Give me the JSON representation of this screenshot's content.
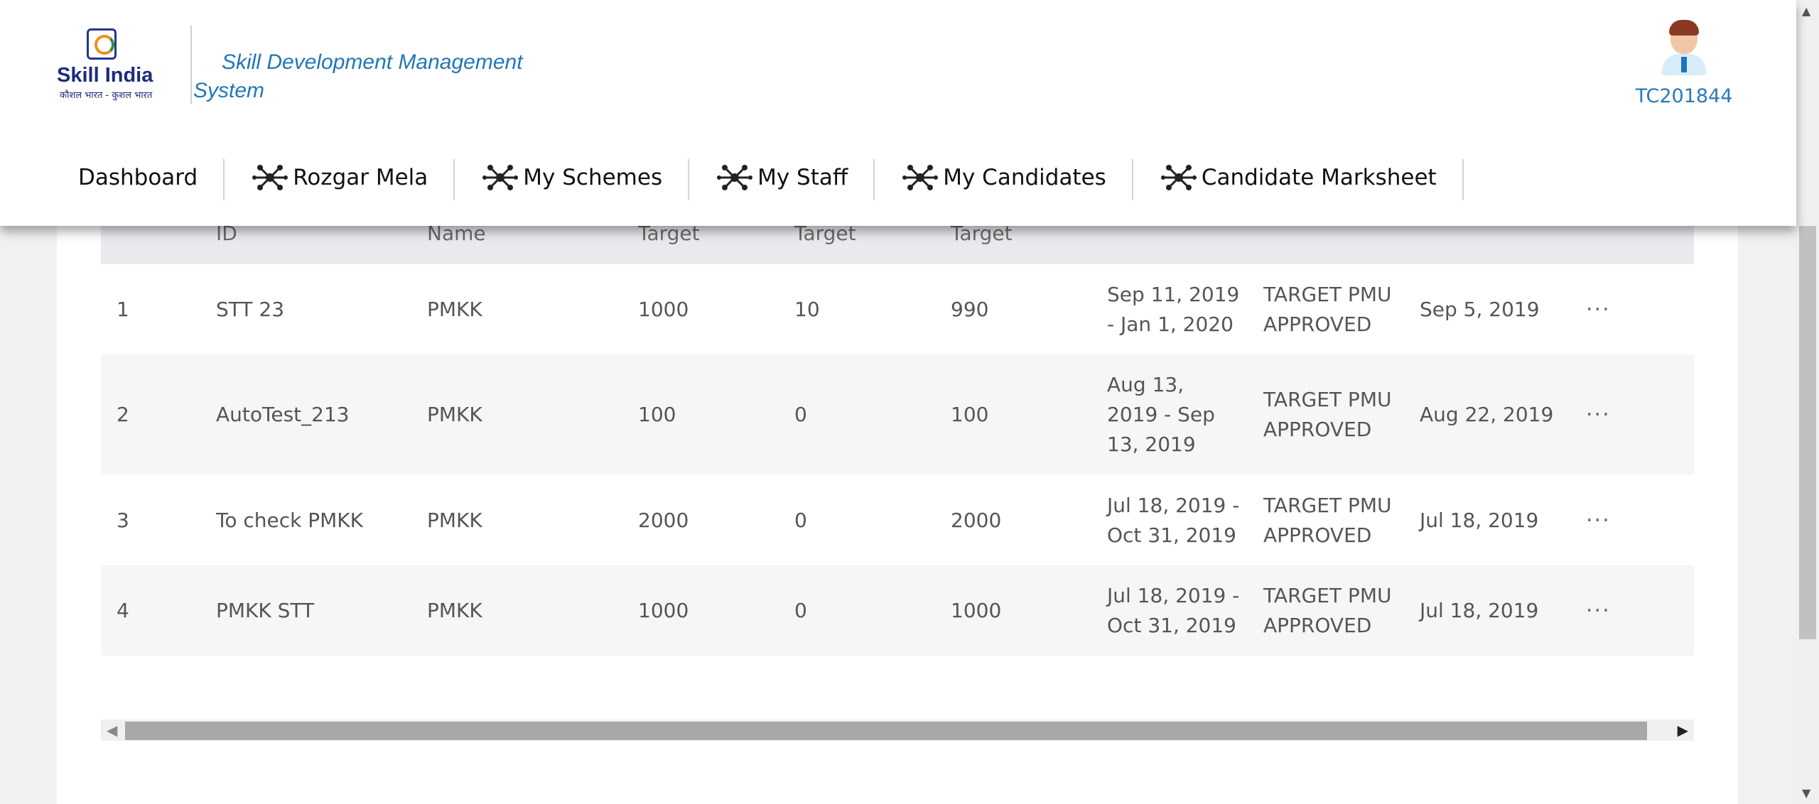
{
  "header": {
    "logo": {
      "brand": "Skill India",
      "tagline": "कौशल भारत - कुशल भारत"
    },
    "app_title": "Skill Development Management System",
    "user_id": "TC201844"
  },
  "nav": {
    "items": [
      {
        "label": "Dashboard",
        "icon": "none"
      },
      {
        "label": "Rozgar Mela",
        "icon": "network-icon"
      },
      {
        "label": "My Schemes",
        "icon": "network-icon"
      },
      {
        "label": "My Staff",
        "icon": "network-icon"
      },
      {
        "label": "My Candidates",
        "icon": "network-icon"
      },
      {
        "label": "Candidate Marksheet",
        "icon": "network-icon"
      }
    ]
  },
  "table": {
    "headers": [
      "",
      "ID",
      "Name",
      "Target",
      "Target",
      "Target",
      "",
      "",
      "",
      ""
    ],
    "rows": [
      {
        "sno": "1",
        "id": "STT 23",
        "name": "PMKK",
        "t1": "1000",
        "t2": "10",
        "t3": "990",
        "duration": "Sep 11, 2019 - Jan 1, 2020",
        "status": "TARGET PMU APPROVED",
        "date": "Sep 5, 2019",
        "more": "···"
      },
      {
        "sno": "2",
        "id": "AutoTest_213",
        "name": "PMKK",
        "t1": "100",
        "t2": "0",
        "t3": "100",
        "duration": "Aug 13, 2019 - Sep 13, 2019",
        "status": "TARGET PMU APPROVED",
        "date": "Aug 22, 2019",
        "more": "···"
      },
      {
        "sno": "3",
        "id": "To check PMKK",
        "name": "PMKK",
        "t1": "2000",
        "t2": "0",
        "t3": "2000",
        "duration": "Jul 18, 2019 - Oct 31, 2019",
        "status": "TARGET PMU APPROVED",
        "date": "Jul 18, 2019",
        "more": "···"
      },
      {
        "sno": "4",
        "id": "PMKK STT",
        "name": "PMKK",
        "t1": "1000",
        "t2": "0",
        "t3": "1000",
        "duration": "Jul 18, 2019 - Oct 31, 2019",
        "status": "TARGET PMU APPROVED",
        "date": "Jul 18, 2019",
        "more": "···"
      }
    ]
  },
  "colors": {
    "accent": "#2276b8",
    "brand": "#1d2b7d",
    "header_row_bg": "#e9eaee"
  }
}
